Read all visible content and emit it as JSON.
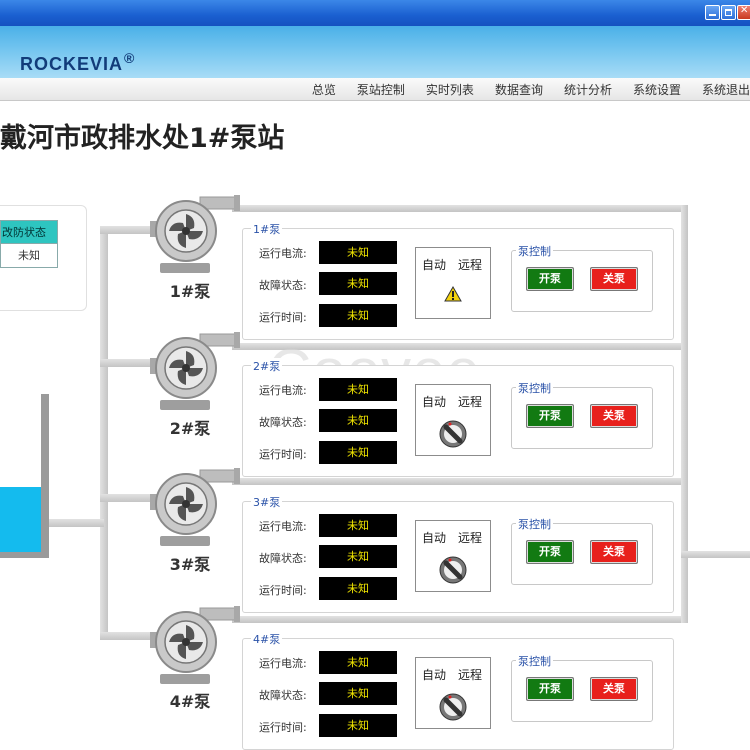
{
  "window": {
    "controls": [
      "minimize-icon",
      "maximize-icon",
      "close-icon"
    ]
  },
  "brand": {
    "name": "ROCKEVIA",
    "mark": "®"
  },
  "menu": [
    "总览",
    "泵站控制",
    "实时列表",
    "数据查询",
    "统计分析",
    "系统设置",
    "系统退出"
  ],
  "page_title": "戴河市政排水处1#泵站",
  "status_table": {
    "header": "改防状态",
    "value": "未知"
  },
  "watermark": "Coovee",
  "pumps": [
    {
      "name": "1#泵",
      "panel_title": "1#泵",
      "rows": [
        {
          "label": "运行电流:",
          "value": "未知"
        },
        {
          "label": "故障状态:",
          "value": "未知"
        },
        {
          "label": "运行时间:",
          "value": "未知"
        }
      ],
      "mode": {
        "auto": "自动",
        "remote": "远程",
        "indicator": "warning-icon"
      },
      "control": {
        "title": "泵控制",
        "open": "开泵",
        "close": "关泵"
      }
    },
    {
      "name": "2#泵",
      "panel_title": "2#泵",
      "rows": [
        {
          "label": "运行电流:",
          "value": "未知"
        },
        {
          "label": "故障状态:",
          "value": "未知"
        },
        {
          "label": "运行时间:",
          "value": "未知"
        }
      ],
      "mode": {
        "auto": "自动",
        "remote": "远程",
        "indicator": "selector-knob-icon"
      },
      "control": {
        "title": "泵控制",
        "open": "开泵",
        "close": "关泵"
      }
    },
    {
      "name": "3#泵",
      "panel_title": "3#泵",
      "rows": [
        {
          "label": "运行电流:",
          "value": "未知"
        },
        {
          "label": "故障状态:",
          "value": "未知"
        },
        {
          "label": "运行时间:",
          "value": "未知"
        }
      ],
      "mode": {
        "auto": "自动",
        "remote": "远程",
        "indicator": "selector-knob-icon"
      },
      "control": {
        "title": "泵控制",
        "open": "开泵",
        "close": "关泵"
      }
    },
    {
      "name": "4#泵",
      "panel_title": "4#泵",
      "rows": [
        {
          "label": "运行电流:",
          "value": "未知"
        },
        {
          "label": "故障状态:",
          "value": "未知"
        },
        {
          "label": "运行时间:",
          "value": "未知"
        }
      ],
      "mode": {
        "auto": "自动",
        "remote": "远程",
        "indicator": "selector-knob-icon"
      },
      "control": {
        "title": "泵控制",
        "open": "开泵",
        "close": "关泵"
      }
    }
  ],
  "colors": {
    "titlebar": "#1a5fd0",
    "header": "#78c7f0",
    "status_header": "#2ec5c0",
    "water": "#14bbee",
    "led_bg": "#000000",
    "led_text": "#f2e600",
    "open_button": "#127a12",
    "close_button": "#e8201c",
    "panel_title": "#2a52a8"
  }
}
